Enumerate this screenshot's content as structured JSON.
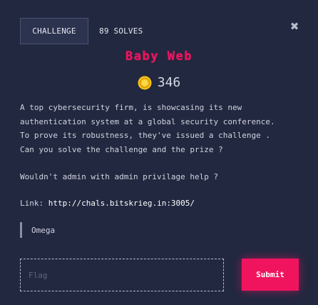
{
  "header": {
    "tab_label": "CHALLENGE",
    "solves_label": "89 SOLVES",
    "close_icon": "close-icon",
    "close_glyph": "✖"
  },
  "challenge": {
    "title": "Baby Web",
    "points": "346",
    "coin_icon": "coin-icon",
    "description_lines": [
      "A top cybersecurity firm, is showcasing its new",
      "authentication system at a global security conference.",
      "To prove its robustness, they've issued a challenge .",
      "Can you solve the challenge and the prize ?"
    ],
    "hint": "Wouldn't admin with admin privilage help ?",
    "link_label": "Link: ",
    "link_url": "http://chals.bitskrieg.in:3005/",
    "author": "Omega"
  },
  "form": {
    "flag_placeholder": "Flag",
    "flag_value": "",
    "submit_label": "Submit"
  },
  "colors": {
    "background": "#222840",
    "accent": "#f0145f",
    "coin": "#f5c518"
  }
}
